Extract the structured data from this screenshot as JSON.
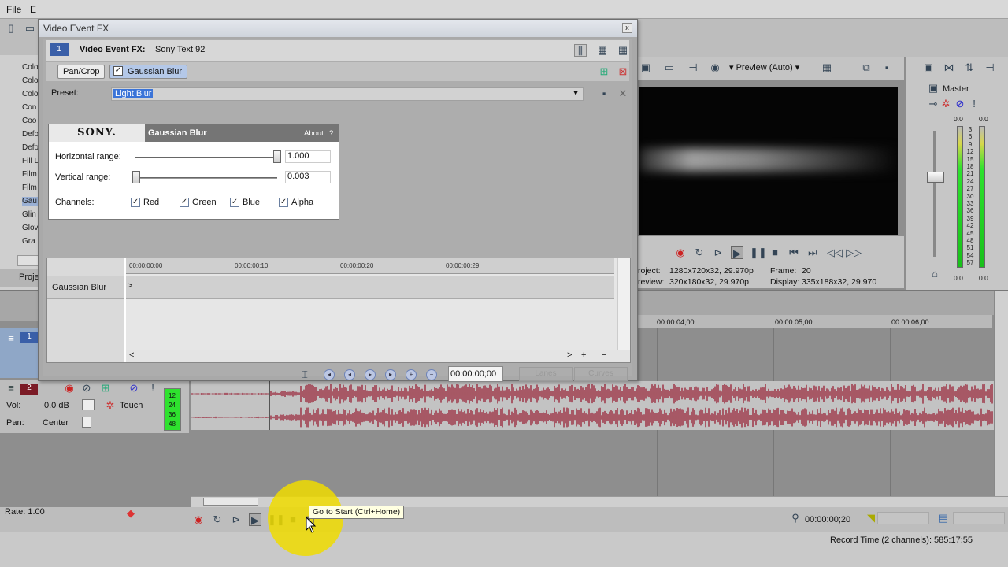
{
  "menubar": {
    "file": "File",
    "edit_partial": "E"
  },
  "explorer": {
    "items": [
      "Colo",
      "Colo",
      "Colo",
      "Con",
      "Coo",
      "Defo",
      "Defo",
      "Fill L",
      "Film",
      "Film",
      "Gau",
      "Glin",
      "Glov",
      "Gra"
    ],
    "tab": "Proje"
  },
  "fx_dialog": {
    "title": "Video Event FX",
    "close": "x",
    "badge": "1",
    "header_label": "Video Event FX:",
    "header_value": "Sony Text 92",
    "chain": [
      "Pan/Crop",
      "Gaussian Blur"
    ],
    "preset_label": "Preset:",
    "preset_value": "Light Blur",
    "plugin": {
      "brand": "SONY.",
      "name": "Gaussian Blur",
      "about": "About",
      "help": "?",
      "params": [
        {
          "label": "Horizontal range:",
          "value": "1.000",
          "level": 1.0
        },
        {
          "label": "Vertical range:",
          "value": "0.003",
          "level": 0.003
        }
      ],
      "channels_label": "Channels:",
      "channels": [
        {
          "label": "Red",
          "checked": true
        },
        {
          "label": "Green",
          "checked": true
        },
        {
          "label": "Blue",
          "checked": true
        },
        {
          "label": "Alpha",
          "checked": true
        }
      ]
    },
    "keyframes": {
      "ruler": [
        "00:00:00:00",
        "00:00:00:10",
        "00:00:00:20",
        "00:00:00:29"
      ],
      "track_label": "Gaussian Blur",
      "time": "00:00:00;00",
      "lanes": "Lanes",
      "curves": "Curves"
    }
  },
  "preview": {
    "mode": "Preview (Auto)",
    "info": {
      "project_label": "roject:",
      "project_value": "1280x720x32, 29.970p",
      "preview_label": "review:",
      "preview_value": "320x180x32, 29.970p",
      "frame_label": "Frame:",
      "frame_value": "20",
      "display_label": "Display:",
      "display_value": "335x188x32, 29.970"
    }
  },
  "master": {
    "title": "Master",
    "peak_left": "0.0",
    "peak_right": "0.0",
    "bottom_left": "0.0",
    "bottom_right": "0.0",
    "scale": [
      "3",
      "6",
      "9",
      "12",
      "15",
      "18",
      "21",
      "24",
      "27",
      "30",
      "33",
      "36",
      "39",
      "42",
      "45",
      "48",
      "51",
      "54",
      "57"
    ]
  },
  "timeline": {
    "ruler": [
      "00:00:04;00",
      "00:00:05;00",
      "00:00:06;00"
    ],
    "track1_number": "1",
    "track2_number": "2",
    "track2_vol_label": "Vol:",
    "track2_vol": "0.0 dB",
    "track2_pan_label": "Pan:",
    "track2_pan": "Center",
    "track2_mode": "Touch",
    "track2_meter": [
      "12",
      "24",
      "36",
      "48"
    ],
    "rate": "Rate: 1.00",
    "position": "00:00:00;20",
    "record_time": "Record Time (2 channels): 585:17:55",
    "tooltip": "Go to Start (Ctrl+Home)"
  },
  "colors": {
    "accent": "#3b74d8",
    "waveform": "#9b2a3d",
    "meter": "#2ee22e",
    "highlight": "#f0dc00"
  }
}
